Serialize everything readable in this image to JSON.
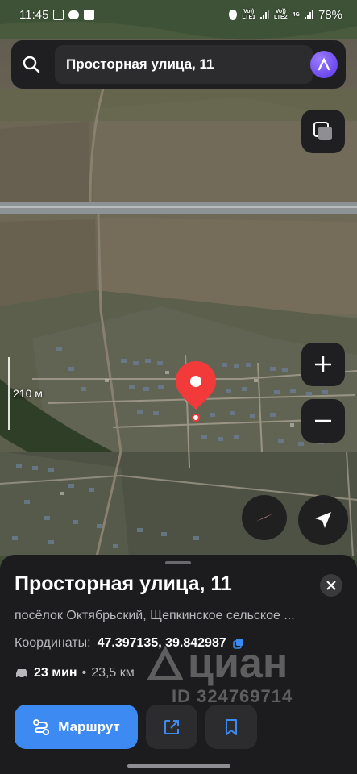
{
  "status_bar": {
    "time": "11:45",
    "network_1": "Vo))\nLTE1",
    "network_2": "Vo))\nLTE2",
    "network_type": "4G",
    "battery": "78%"
  },
  "search": {
    "query": "Просторная улица, 11",
    "icon": "search-icon"
  },
  "map": {
    "scale_label": "210 м",
    "controls": [
      "layers-icon",
      "zoom-in-icon",
      "zoom-out-icon",
      "compass-icon",
      "my-location-icon"
    ],
    "pin_color": "#f33a3a"
  },
  "place_card": {
    "title": "Просторная улица, 11",
    "subtitle": "посёлок Октябрьский, Щепкинское сельское ...",
    "coords_label": "Координаты:",
    "coords_value": "47.397135, 39.842987",
    "route_time": "23 мин",
    "route_separator": "•",
    "route_distance": "23,5 км",
    "watermark_brand": "циан",
    "watermark_id": "ID 324769714",
    "route_button": "Маршрут",
    "accent_color": "#3d8bf2"
  }
}
